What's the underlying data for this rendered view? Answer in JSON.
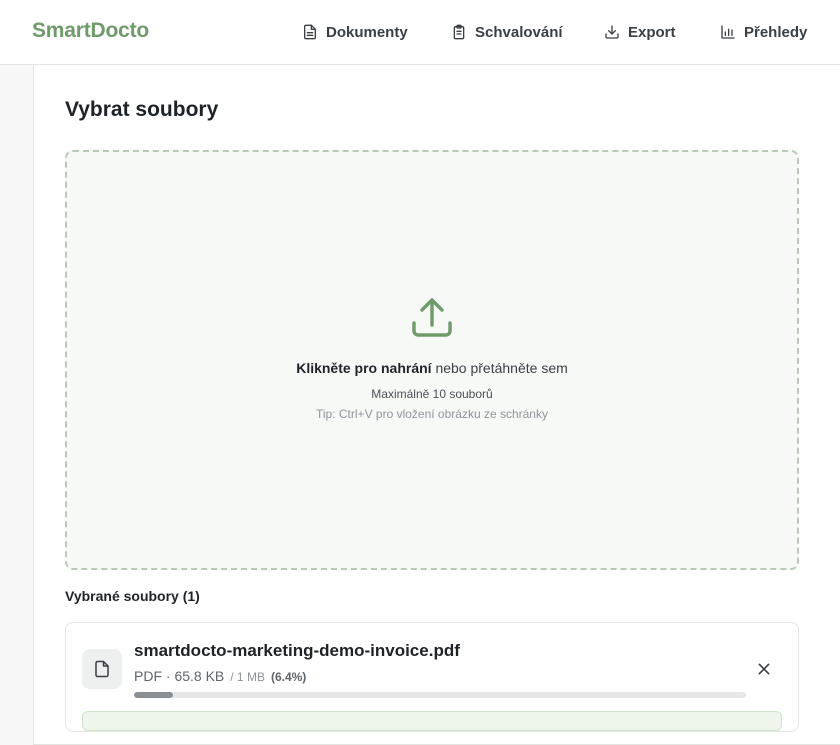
{
  "header": {
    "brand": "SmartDocto",
    "nav": [
      {
        "label": "Dokumenty",
        "icon": "document-icon"
      },
      {
        "label": "Schvalování",
        "icon": "clipboard-icon"
      },
      {
        "label": "Export",
        "icon": "download-icon"
      },
      {
        "label": "Přehledy",
        "icon": "bar-chart-icon"
      }
    ]
  },
  "main": {
    "title": "Vybrat soubory",
    "dropzone": {
      "icon": "upload-icon",
      "click_bold": "Klikněte pro nahrání",
      "click_rest": " nebo přetáhněte sem",
      "max_files": "Maximálně 10 souborů",
      "tip": "Tip: Ctrl+V pro vložení obrázku ze schránky"
    },
    "selected_title": "Vybrané soubory (1)",
    "files": [
      {
        "name": "smartdocto-marketing-demo-invoice.pdf",
        "meta": "PDF · 65.8 KB",
        "limit": "/ 1 MB",
        "percent": "(6.4%)",
        "progress": 0.064
      }
    ]
  },
  "colors": {
    "brand": "#6f9a6a",
    "accent_icon": "#6f9a6a",
    "dropzone_border": "#b9c9b7"
  }
}
